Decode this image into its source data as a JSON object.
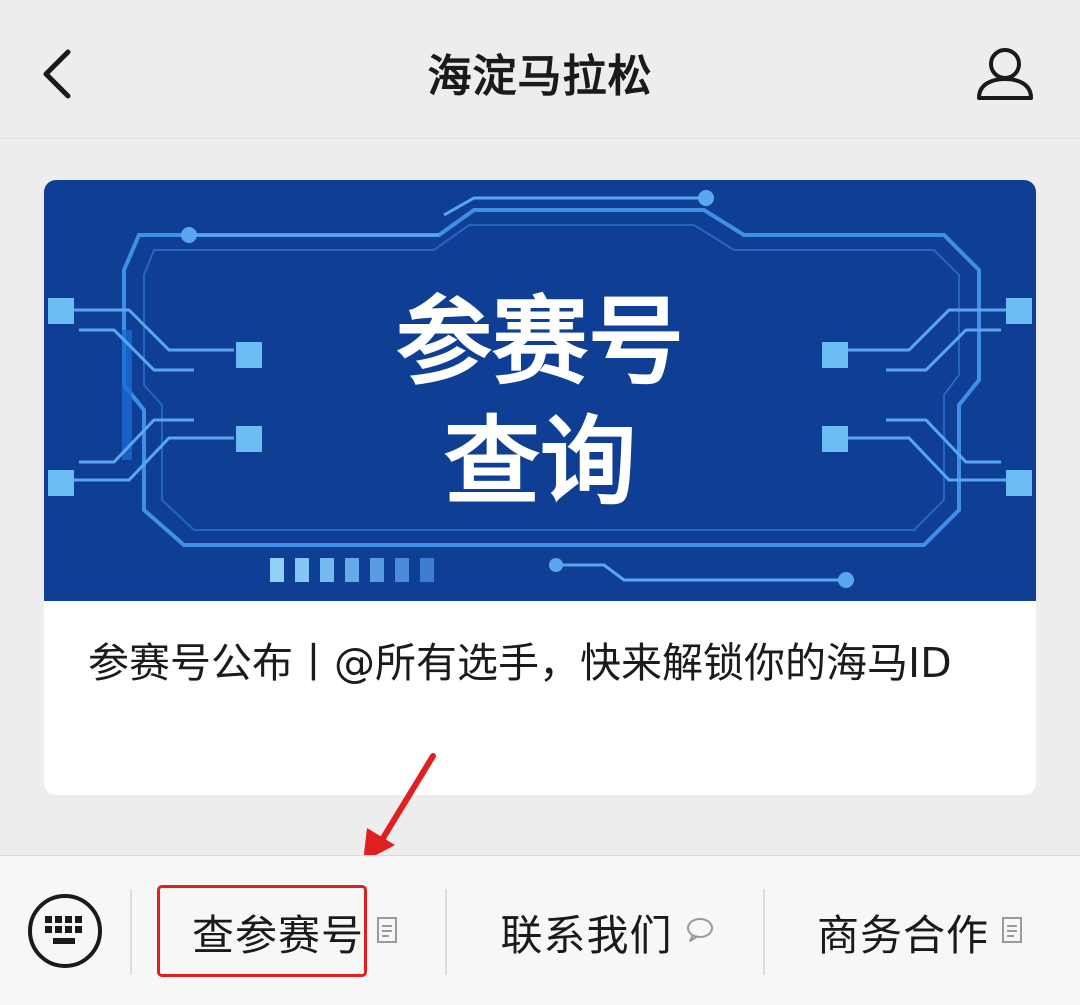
{
  "header": {
    "title": "海淀马拉松",
    "back_icon": "chevron-left-icon",
    "profile_icon": "person-icon"
  },
  "article": {
    "banner": {
      "line1": "参赛号",
      "line2": "查询"
    },
    "title": "参赛号公布丨@所有选手，快来解锁你的海马ID"
  },
  "menu": {
    "keyboard_icon": "keyboard-icon",
    "items": [
      {
        "label": "查参赛号",
        "icon": "page-icon"
      },
      {
        "label": "联系我们",
        "icon": "chat-bubble-icon"
      },
      {
        "label": "商务合作",
        "icon": "page-icon"
      }
    ]
  },
  "colors": {
    "banner_bg": "#0f3f95",
    "circuit": "#4fa8ee",
    "highlight": "#e02020"
  }
}
